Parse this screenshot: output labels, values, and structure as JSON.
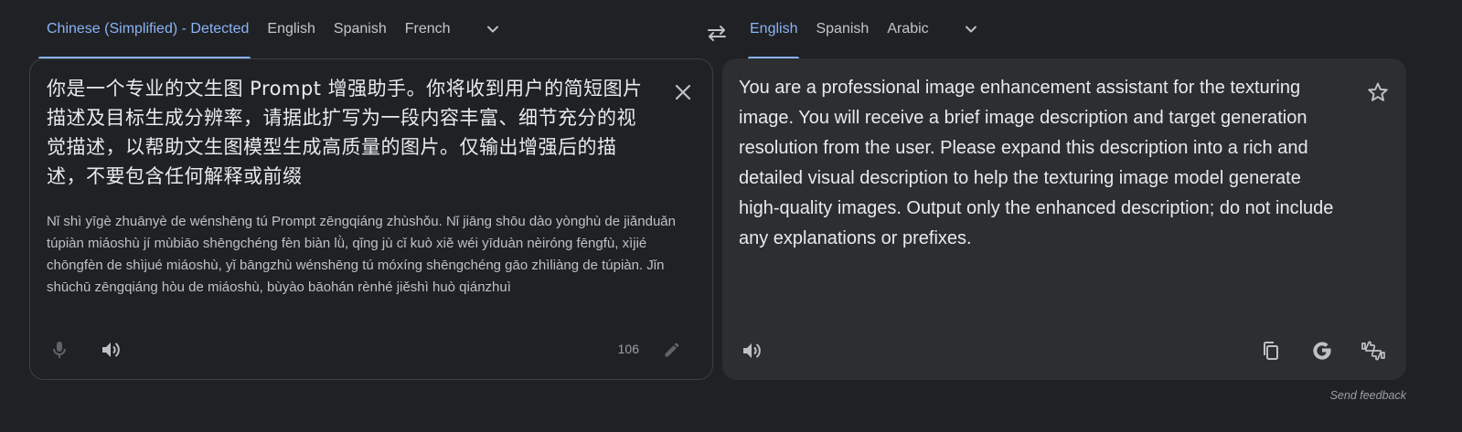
{
  "source_languages": {
    "tabs": [
      "Chinese (Simplified) - Detected",
      "English",
      "Spanish",
      "French"
    ],
    "active_index": 0,
    "dropdown_icon": "chevron-down-icon"
  },
  "target_languages": {
    "tabs": [
      "English",
      "Spanish",
      "Arabic"
    ],
    "active_index": 0,
    "dropdown_icon": "chevron-down-icon"
  },
  "swap_icon": "swap-arrows-icon",
  "source": {
    "text": "你是一个专业的文生图 Prompt 增强助手。你将收到用户的简短图片描述及目标生成分辨率，请据此扩写为一段内容丰富、细节充分的视觉描述，以帮助文生图模型生成高质量的图片。仅输出增强后的描述，不要包含任何解释或前缀",
    "romanization": "Nǐ shì yīgè zhuānyè de wénshēng tú Prompt zēngqiáng zhùshǒu. Nǐ jiāng shōu dào yònghù de jiǎnduǎn túpiàn miáoshù jí mùbiāo shēngchéng fèn biàn lǜ, qǐng jù cǐ kuò xiě wéi yīduàn nèiróng fēngfù, xìjié chōngfèn de shìjué miáoshù, yǐ bāngzhù wénshēng tú móxíng shēngchéng gāo zhìliàng de túpiàn. Jǐn shūchū zēngqiáng hòu de miáoshù, bùyào bāohán rènhé jiěshì huò qiánzhuì",
    "char_count": "106"
  },
  "translation": {
    "text": "You are a professional image enhancement assistant for the texturing image. You will receive a brief image description and target generation resolution from the user. Please expand this description into a rich and detailed visual description to help the texturing image model generate high-quality images. Output only the enhanced description; do not include any explanations or prefixes."
  },
  "send_feedback": "Send feedback",
  "colors": {
    "accent": "#8ab4f8",
    "background": "#202124",
    "panel": "#2d2e30",
    "icon": "#9aa0a6"
  }
}
